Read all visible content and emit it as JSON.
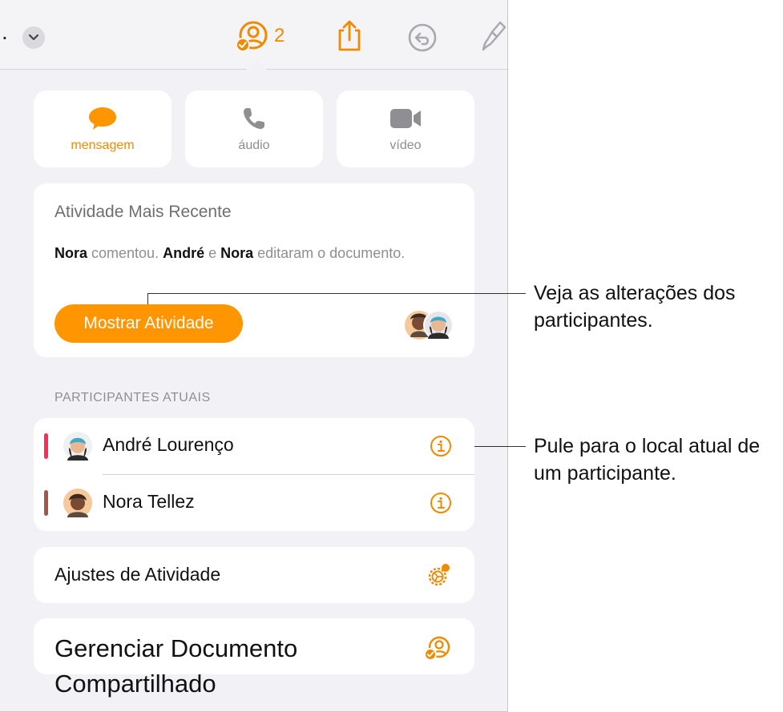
{
  "toolbar": {
    "dot": ".",
    "collaborator_count": "2"
  },
  "contact_buttons": [
    {
      "label": "mensagem",
      "icon": "message-bubble-icon",
      "active": true
    },
    {
      "label": "áudio",
      "icon": "phone-icon",
      "active": false
    },
    {
      "label": "vídeo",
      "icon": "video-camera-icon",
      "active": false
    }
  ],
  "activity": {
    "title": "Atividade Mais Recente",
    "name1": "Nora",
    "text1": " comentou. ",
    "name2": "André",
    "text2": " e ",
    "name3": "Nora",
    "text3": " editaram o documento.",
    "button_label": "Mostrar Atividade"
  },
  "participants": {
    "header": "PARTICIPANTES ATUAIS",
    "items": [
      {
        "name": "André Lourenço",
        "color": "#ff2d55"
      },
      {
        "name": "Nora Tellez",
        "color": "#a2574d"
      }
    ]
  },
  "settings": {
    "label": "Ajustes de Atividade"
  },
  "manage": {
    "label": "Gerenciar Documento Compartilhado"
  },
  "callouts": {
    "changes": "Veja as alterações dos participantes.",
    "jump": "Pule para o local atual de um participante."
  },
  "colors": {
    "accent": "#ff9500",
    "accent_text": "#f08a00"
  }
}
